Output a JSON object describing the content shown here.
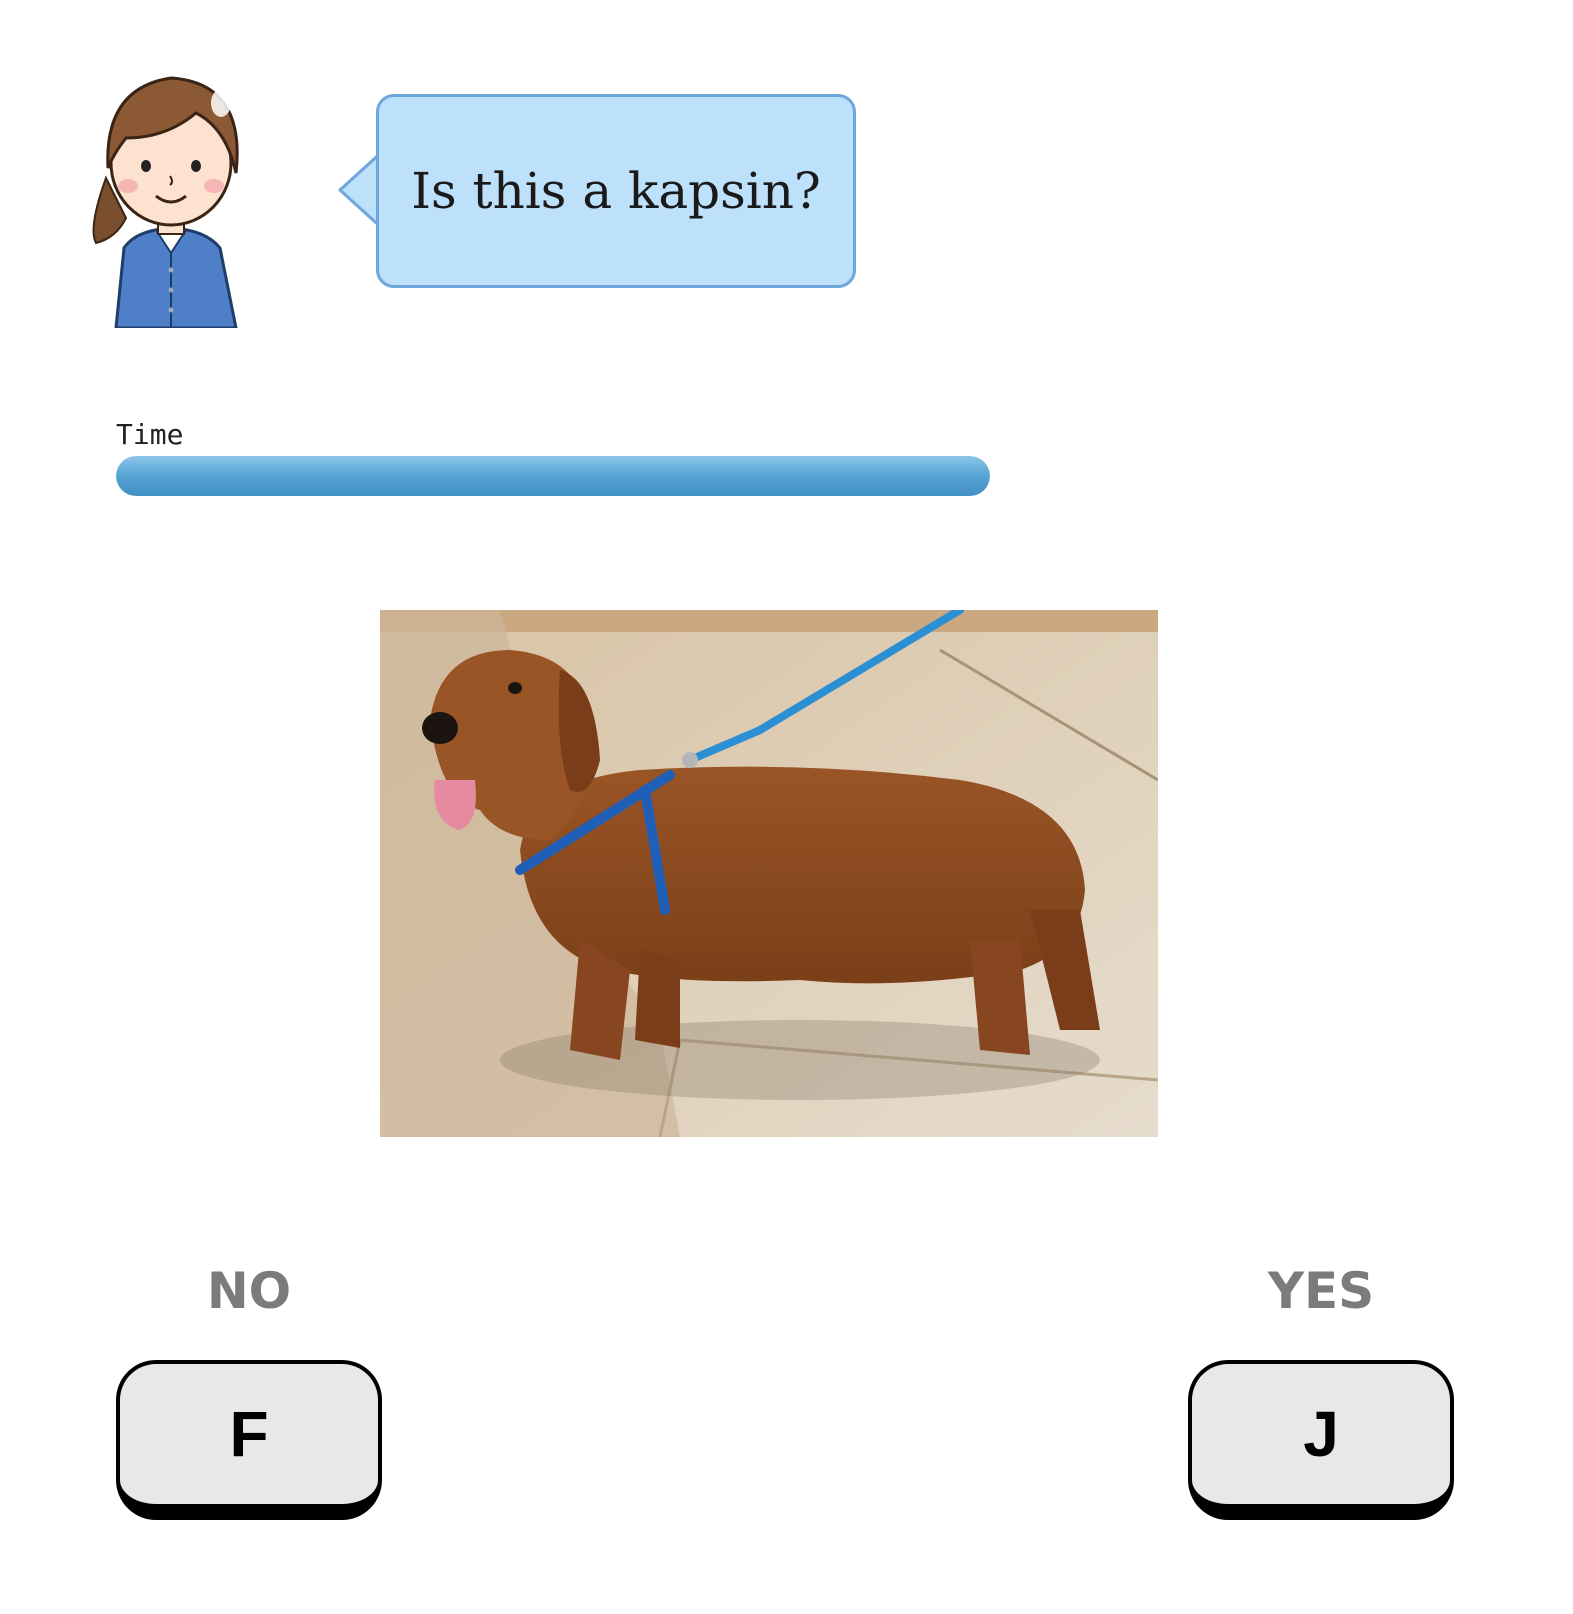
{
  "speaker": {
    "icon": "teacher-avatar-icon",
    "question": "Is this a kapsin?"
  },
  "timer": {
    "label": "Time",
    "remaining_fraction": 1.0,
    "color": "#4a9ad0"
  },
  "stimulus": {
    "icon": "dachshund-photo"
  },
  "responses": {
    "no": {
      "label": "NO",
      "key": "F"
    },
    "yes": {
      "label": "YES",
      "key": "J"
    }
  }
}
